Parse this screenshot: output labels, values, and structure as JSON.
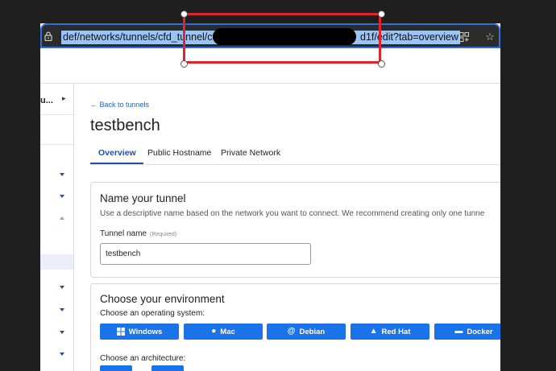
{
  "browser": {
    "url_visible_prefix": "def/networks/tunnels/cfd_tunnel/c8c",
    "url_visible_suffix": "d1f/edit?tab=overview",
    "lock_icon": "lock-icon",
    "split_icon": "split-view-icon",
    "star_icon": "star-icon"
  },
  "sidebar": {
    "title": "u...",
    "arrow": "▸"
  },
  "page": {
    "back_link": "← Back to tunnels",
    "title": "testbench",
    "tabs": [
      {
        "label": "Overview",
        "active": true
      },
      {
        "label": "Public Hostname",
        "active": false
      },
      {
        "label": "Private Network",
        "active": false
      }
    ]
  },
  "name_card": {
    "title": "Name your tunnel",
    "description": "Use a descriptive name based on the network you want to connect. We recommend creating only one tunne",
    "field_label": "Tunnel name",
    "field_required": "(Required)",
    "field_value": "testbench"
  },
  "env_card": {
    "title": "Choose your environment",
    "os_label": "Choose an operating system:",
    "os_options": [
      {
        "label": "Windows",
        "icon": "windows-icon"
      },
      {
        "label": "Mac",
        "icon": "apple-icon"
      },
      {
        "label": "Debian",
        "icon": "debian-icon"
      },
      {
        "label": "Red Hat",
        "icon": "redhat-icon"
      },
      {
        "label": "Docker",
        "icon": "docker-icon"
      }
    ],
    "arch_label": "Choose an architecture:"
  },
  "colors": {
    "accent": "#1a73e8",
    "link": "#1f63c7",
    "highlight": "#e0242b",
    "url_selection": "#9cc4f3"
  }
}
